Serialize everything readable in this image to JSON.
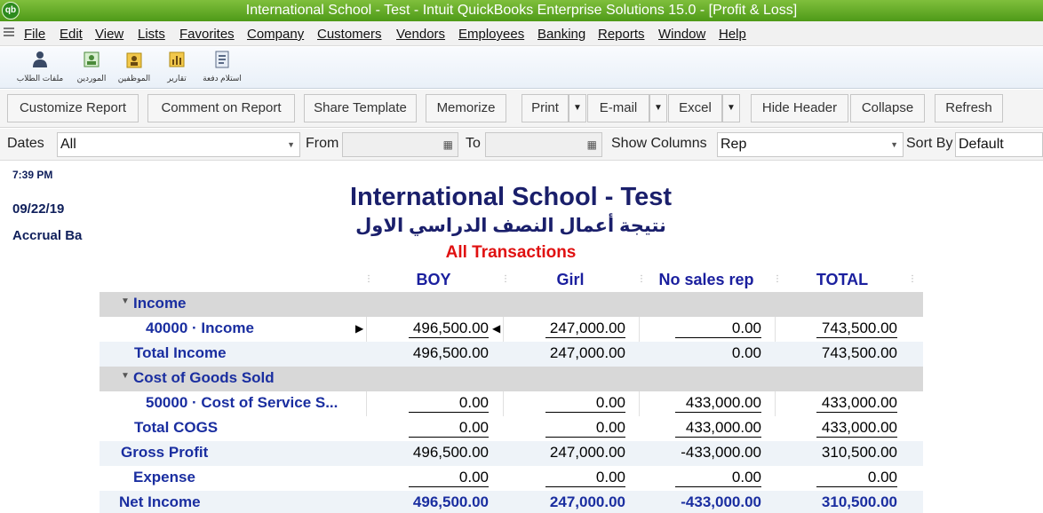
{
  "window": {
    "title": "International School - Test  - Intuit QuickBooks Enterprise Solutions 15.0 - [Profit & Loss]",
    "logo_text": "qb"
  },
  "menu": {
    "items": [
      "File",
      "Edit",
      "View",
      "Lists",
      "Favorites",
      "Company",
      "Customers",
      "Vendors",
      "Employees",
      "Banking",
      "Reports",
      "Window",
      "Help"
    ]
  },
  "iconbar": {
    "items": [
      {
        "label": "ملفات الطلاب",
        "icon": "student-files-icon"
      },
      {
        "label": "الموردين",
        "icon": "vendors-icon"
      },
      {
        "label": "الموظفين",
        "icon": "employees-icon"
      },
      {
        "label": "تقارير",
        "icon": "reports-icon"
      },
      {
        "label": "استلام دفعة",
        "icon": "receive-payment-icon"
      }
    ]
  },
  "toolbar": {
    "customize": "Customize Report",
    "comment": "Comment on Report",
    "share": "Share Template",
    "memorize": "Memorize",
    "print": "Print",
    "email": "E-mail",
    "excel": "Excel",
    "hide_header": "Hide Header",
    "collapse": "Collapse",
    "refresh": "Refresh"
  },
  "filters": {
    "dates_label": "Dates",
    "dates_value": "All",
    "from_label": "From",
    "from_value": "",
    "to_label": "To",
    "to_value": "",
    "show_columns_label": "Show Columns",
    "show_columns_value": "Rep",
    "sort_by_label": "Sort By",
    "sort_by_value": "Default"
  },
  "report": {
    "time": "7:39 PM",
    "date": "09/22/19",
    "basis": "Accrual Ba",
    "company": "International School - Test",
    "subtitle": "نتيجة أعمال النصف الدراسي الاول",
    "transactions": "All Transactions",
    "columns": [
      "BOY",
      "Girl",
      "No sales rep",
      "TOTAL"
    ],
    "rows": {
      "income_header": "Income",
      "income_40000": {
        "label": "40000 · Income",
        "values": [
          "496,500.00",
          "247,000.00",
          "0.00",
          "743,500.00"
        ]
      },
      "total_income": {
        "label": "Total Income",
        "values": [
          "496,500.00",
          "247,000.00",
          "0.00",
          "743,500.00"
        ]
      },
      "cogs_header": "Cost of Goods Sold",
      "cogs_50000": {
        "label": "50000 · Cost of Service S...",
        "values": [
          "0.00",
          "0.00",
          "433,000.00",
          "433,000.00"
        ]
      },
      "total_cogs": {
        "label": "Total COGS",
        "values": [
          "0.00",
          "0.00",
          "433,000.00",
          "433,000.00"
        ]
      },
      "gross_profit": {
        "label": "Gross Profit",
        "values": [
          "496,500.00",
          "247,000.00",
          "-433,000.00",
          "310,500.00"
        ]
      },
      "expense": {
        "label": "Expense",
        "values": [
          "0.00",
          "0.00",
          "0.00",
          "0.00"
        ]
      },
      "net_income": {
        "label": "Net Income",
        "values": [
          "496,500.00",
          "247,000.00",
          "-433,000.00",
          "310,500.00"
        ]
      }
    }
  },
  "colors": {
    "titlebar": "#5aa522",
    "header_text": "#1a1f6b",
    "row_label": "#1a2ea0",
    "transactions": "#e01010"
  }
}
